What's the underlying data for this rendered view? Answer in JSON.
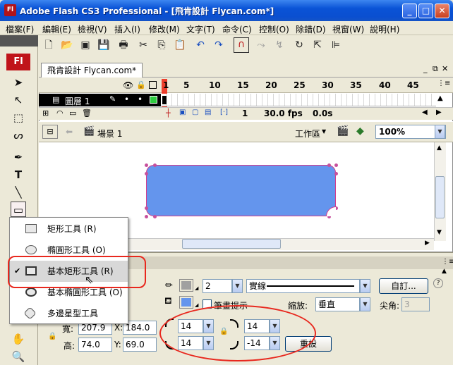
{
  "window": {
    "title": "Adobe Flash CS3 Professional - [飛肯設計  Flycan.com*]",
    "logo": "Fl",
    "controls": [
      "minimize",
      "maximize",
      "close"
    ]
  },
  "menu": [
    "檔案(F)",
    "編輯(E)",
    "檢視(V)",
    "插入(I)",
    "修改(M)",
    "文字(T)",
    "命令(C)",
    "控制(O)",
    "除錯(D)",
    "視窗(W)",
    "說明(H)"
  ],
  "toolbar_icons": [
    "new-icon",
    "open-icon",
    "bridge-icon",
    "save-icon",
    "print-icon",
    "cut-icon",
    "copy-icon",
    "paste-icon",
    "undo-icon",
    "redo-icon",
    "snap-magnet-icon",
    "smooth-icon",
    "straighten-icon",
    "rotate-icon",
    "scale-icon",
    "align-icon"
  ],
  "tools": {
    "logo": "Fl"
  },
  "document": {
    "tab_label": "飛肯設計  Flycan.com*"
  },
  "timeline": {
    "frame_numbers": [
      "1",
      "5",
      "10",
      "15",
      "20",
      "25",
      "30",
      "35",
      "40",
      "45"
    ],
    "layer_name": "圖層 1",
    "current_frame": "1",
    "fps": "30.0 fps",
    "time": "0.0s"
  },
  "editbar": {
    "scene": "場景 1",
    "workspace": "工作區",
    "zoom": "100%"
  },
  "stage": {
    "shape_fill": "#6495ed",
    "shape_stroke": "#d43c8c"
  },
  "flyout": {
    "items": [
      {
        "label": "矩形工具 (R)",
        "icon": "rectangle-tool-icon",
        "checked": false
      },
      {
        "label": "橢圓形工具 (O)",
        "icon": "oval-tool-icon",
        "checked": false
      },
      {
        "label": "基本矩形工具 (R)",
        "icon": "primitive-rectangle-tool-icon",
        "checked": true
      },
      {
        "label": "基本橢圓形工具 (O)",
        "icon": "primitive-oval-tool-icon",
        "checked": false
      },
      {
        "label": "多邊星型工具",
        "icon": "polystar-tool-icon",
        "checked": false
      }
    ],
    "checkmark": "✔"
  },
  "properties": {
    "stroke_height": "2",
    "stroke_style": "實線",
    "custom_button": "自訂...",
    "hinting_label": "筆畫提示",
    "scale_label": "縮放:",
    "scale_value": "垂直",
    "miter_label": "尖角:",
    "miter_value": "3",
    "w_label": "寬:",
    "w_value": "207.9",
    "x_label": "X:",
    "x_value": "184.0",
    "h_label": "高:",
    "h_value": "74.0",
    "y_label": "Y:",
    "y_value": "69.0",
    "corner_tl": "14",
    "corner_tr": "14",
    "corner_bl": "14",
    "corner_br": "-14",
    "reset_button": "重設",
    "stroke_color": "#a0a0a0",
    "fill_color": "#6495ed"
  },
  "annotation_color": "#e8281e"
}
